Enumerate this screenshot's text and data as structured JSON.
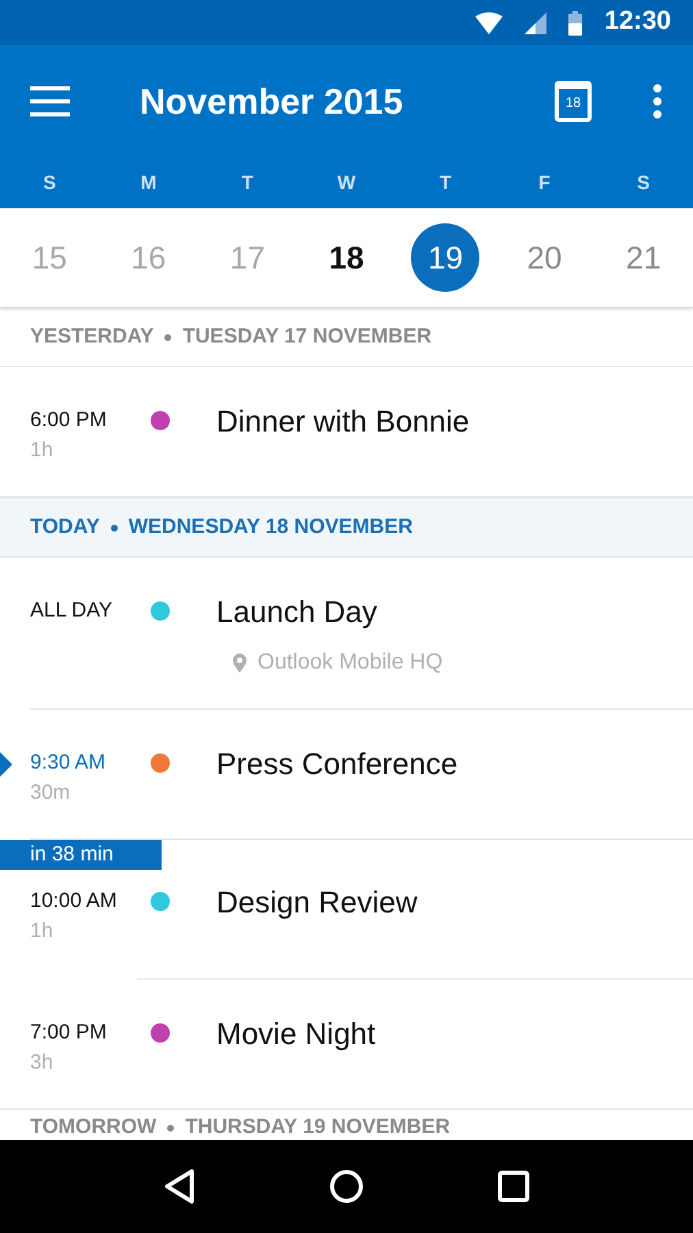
{
  "status_bar": {
    "time": "12:30"
  },
  "app_bar": {
    "title": "November 2015",
    "calendar_icon_day": "18"
  },
  "week": [
    {
      "weekday": "S",
      "date": "15",
      "kind": "past",
      "selected": false
    },
    {
      "weekday": "M",
      "date": "16",
      "kind": "past",
      "selected": false
    },
    {
      "weekday": "T",
      "date": "17",
      "kind": "past",
      "selected": false
    },
    {
      "weekday": "W",
      "date": "18",
      "kind": "today",
      "selected": false
    },
    {
      "weekday": "T",
      "date": "19",
      "selected": true
    },
    {
      "weekday": "F",
      "date": "20",
      "kind": "future",
      "selected": false
    },
    {
      "weekday": "S",
      "date": "21",
      "kind": "future",
      "selected": false
    }
  ],
  "agenda": [
    {
      "label": "YESTERDAY",
      "date": "TUESDAY 17 NOVEMBER",
      "today": false,
      "events": [
        {
          "time": "6:00 PM",
          "duration": "1h",
          "title": "Dinner with Bonnie",
          "color": "#c040b0",
          "current": false
        }
      ]
    },
    {
      "label": "TODAY",
      "date": "WEDNESDAY 18 NOVEMBER",
      "today": true,
      "events": [
        {
          "time": "ALL DAY",
          "title": "Launch Day",
          "location": "Outlook Mobile HQ",
          "color": "#30c8e0",
          "current": false
        },
        {
          "time": "9:30 AM",
          "duration": "30m",
          "title": "Press Conference",
          "color": "#f07838",
          "current": true
        },
        {
          "countdown": "in 38 min",
          "time": "10:00 AM",
          "duration": "1h",
          "title": "Design Review",
          "color": "#30c8e0",
          "current": false
        },
        {
          "time": "7:00 PM",
          "duration": "3h",
          "title": "Movie Night",
          "color": "#c040b0",
          "current": false
        }
      ]
    },
    {
      "label": "TOMORROW",
      "date": "THURSDAY 19 NOVEMBER",
      "today": false
    }
  ]
}
